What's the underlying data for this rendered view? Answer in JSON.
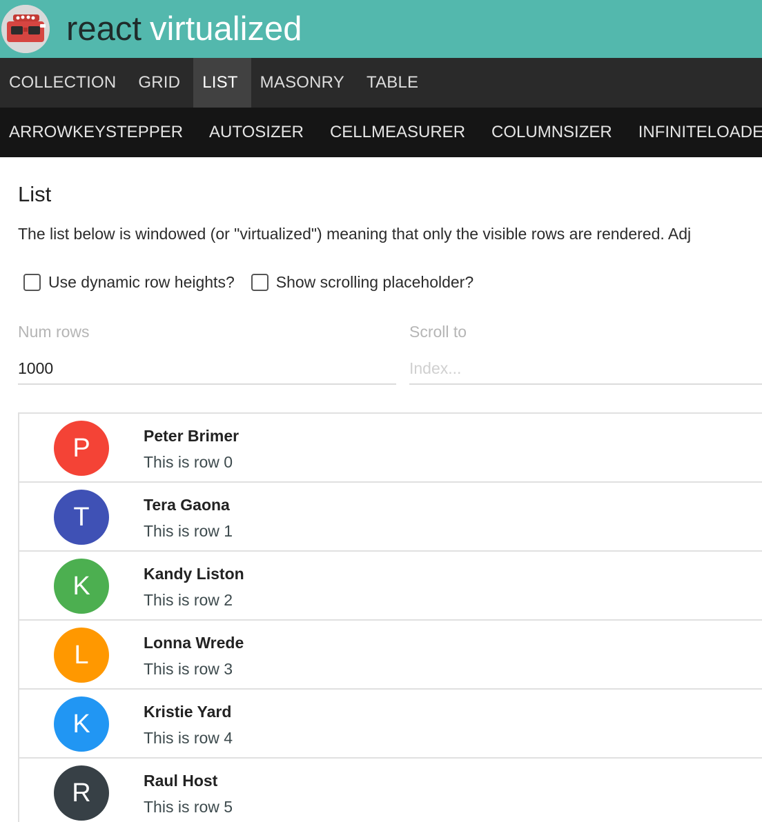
{
  "header": {
    "title_part1": "react",
    "title_part2": "virtualized",
    "logo_icon": "viewmaster-logo-icon",
    "colors": {
      "background": "#53b8ad",
      "title_dark": "#1f2b2a",
      "title_light": "#ffffff"
    }
  },
  "nav_primary": {
    "items": [
      {
        "label": "COLLECTION",
        "active": false
      },
      {
        "label": "GRID",
        "active": false
      },
      {
        "label": "LIST",
        "active": true
      },
      {
        "label": "MASONRY",
        "active": false
      },
      {
        "label": "TABLE",
        "active": false
      }
    ]
  },
  "nav_secondary": {
    "items": [
      {
        "label": "ARROWKEYSTEPPER"
      },
      {
        "label": "AUTOSIZER"
      },
      {
        "label": "CELLMEASURER"
      },
      {
        "label": "COLUMNSIZER"
      },
      {
        "label": "INFINITELOADER"
      }
    ]
  },
  "main": {
    "title": "List",
    "description": "The list below is windowed (or \"virtualized\") meaning that only the visible rows are rendered. Adj",
    "options": {
      "dynamic_heights_label": "Use dynamic row heights?",
      "dynamic_heights_checked": false,
      "scrolling_placeholder_label": "Show scrolling placeholder?",
      "scrolling_placeholder_checked": false
    },
    "num_rows": {
      "label": "Num rows",
      "value": "1000"
    },
    "scroll_to": {
      "label": "Scroll to",
      "placeholder": "Index..."
    }
  },
  "list": {
    "rows": [
      {
        "initial": "P",
        "name": "Peter Brimer",
        "subtitle": "This is row 0",
        "color": "#f44336"
      },
      {
        "initial": "T",
        "name": "Tera Gaona",
        "subtitle": "This is row 1",
        "color": "#3f51b5"
      },
      {
        "initial": "K",
        "name": "Kandy Liston",
        "subtitle": "This is row 2",
        "color": "#4caf50"
      },
      {
        "initial": "L",
        "name": "Lonna Wrede",
        "subtitle": "This is row 3",
        "color": "#ff9800"
      },
      {
        "initial": "K",
        "name": "Kristie Yard",
        "subtitle": "This is row 4",
        "color": "#2196f3"
      },
      {
        "initial": "R",
        "name": "Raul Host",
        "subtitle": "This is row 5",
        "color": "#374046"
      }
    ]
  }
}
